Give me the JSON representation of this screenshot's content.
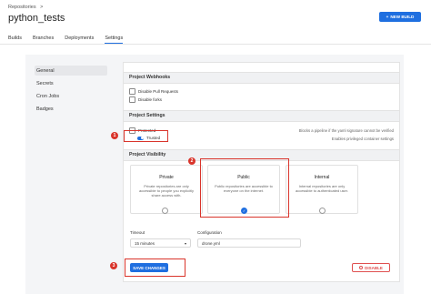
{
  "header": {
    "breadcrumb": "Repositories",
    "breadcrumb_sep": ">",
    "title": "python_tests",
    "new_build_label": "NEW BUILD",
    "new_build_icon": "+"
  },
  "tabs": [
    {
      "label": "Builds"
    },
    {
      "label": "Branches"
    },
    {
      "label": "Deployments"
    },
    {
      "label": "Settings",
      "active": true
    }
  ],
  "sidebar": {
    "items": [
      {
        "label": "General",
        "active": true
      },
      {
        "label": "Secrets"
      },
      {
        "label": "Cron Jobs"
      },
      {
        "label": "Badges"
      }
    ]
  },
  "webhooks": {
    "heading": "Project Webhooks",
    "options": [
      {
        "label": "Disable Pull Requests"
      },
      {
        "label": "Disable forks"
      }
    ]
  },
  "project_settings": {
    "heading": "Project Settings",
    "protected_label": "Protected",
    "protected_desc": "Blocks a pipeline if the yaml signature cannot be verified",
    "trusted_label": "Trusted",
    "trusted_desc": "Enables privileged container settings"
  },
  "visibility": {
    "heading": "Project Visibility",
    "options": [
      {
        "title": "Private",
        "desc": "Private repositories are only accessible to people you explicitly share access with."
      },
      {
        "title": "Public",
        "desc": "Public repositories are accessible to everyone on the internet.",
        "selected": true
      },
      {
        "title": "Internal",
        "desc": "Internal repositories are only accessible to authenticated user."
      }
    ]
  },
  "timeout": {
    "label": "Timeout",
    "value": "15 minutes"
  },
  "configuration": {
    "label": "Configuration",
    "value": "drone.yml"
  },
  "actions": {
    "save_label": "SAVE CHANGES",
    "disable_label": "DISABLE"
  },
  "markers": [
    "1",
    "2",
    "3"
  ],
  "colors": {
    "accent": "#1f6fe0",
    "highlight": "#d9342b",
    "danger": "#e05050"
  }
}
